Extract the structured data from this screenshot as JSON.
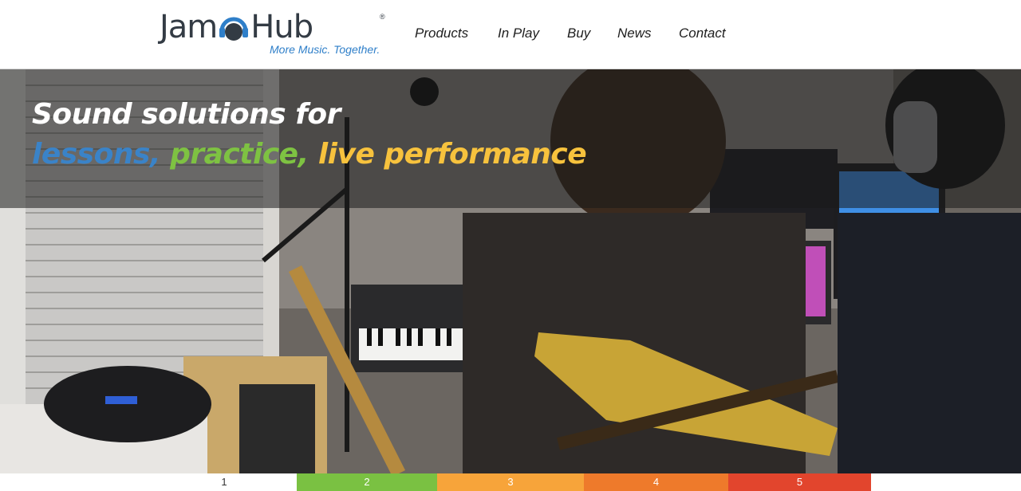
{
  "logo": {
    "part1": "Jam",
    "part2": "Hub",
    "registered": "®",
    "tagline": "More Music. Together."
  },
  "nav": {
    "items": [
      "Products",
      "In Play",
      "Buy",
      "News",
      "Contact"
    ]
  },
  "hero": {
    "line1": "Sound solutions for",
    "line2": {
      "word1": "lessons,",
      "word2": "practice,",
      "word3": "live performance"
    },
    "image_alt": "Musicians playing guitar and keyboard in a home studio"
  },
  "slider": {
    "tabs": [
      "1",
      "2",
      "3",
      "4",
      "5"
    ],
    "active_index": 0,
    "colors": [
      "#ffffff",
      "#7ac142",
      "#f7a43a",
      "#ee7a2b",
      "#e2452d"
    ]
  },
  "colors": {
    "brand_blue": "#2f7fc9",
    "logo_dark": "#333b44",
    "accent_blue": "#3a83c8",
    "accent_green": "#7ec242",
    "accent_yellow": "#f7c23d"
  }
}
